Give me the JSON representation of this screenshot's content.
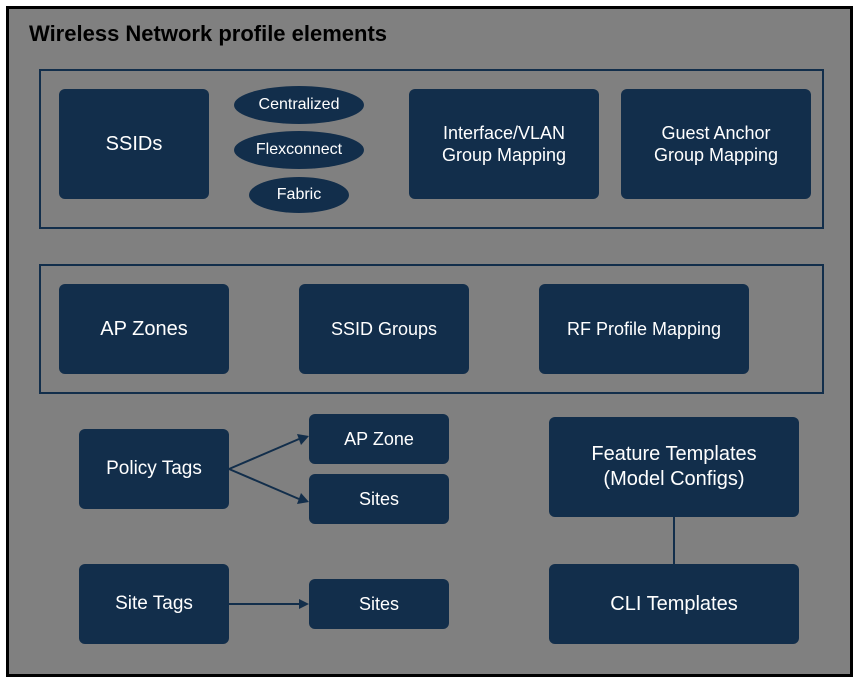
{
  "title": "Wireless Network profile elements",
  "group1": {
    "ssids": "SSIDs",
    "pill_centralized": "Centralized",
    "pill_flexconnect": "Flexconnect",
    "pill_fabric": "Fabric",
    "interface_vlan": "Interface/VLAN\nGroup Mapping",
    "guest_anchor": "Guest Anchor\nGroup Mapping"
  },
  "group2": {
    "ap_zones": "AP Zones",
    "ssid_groups": "SSID Groups",
    "rf_profile": "RF Profile Mapping"
  },
  "row3": {
    "policy_tags": "Policy Tags",
    "ap_zone": "AP Zone",
    "sites": "Sites",
    "feature_templates": "Feature Templates\n(Model Configs)"
  },
  "row4": {
    "site_tags": "Site Tags",
    "sites": "Sites",
    "cli_templates": "CLI Templates"
  }
}
